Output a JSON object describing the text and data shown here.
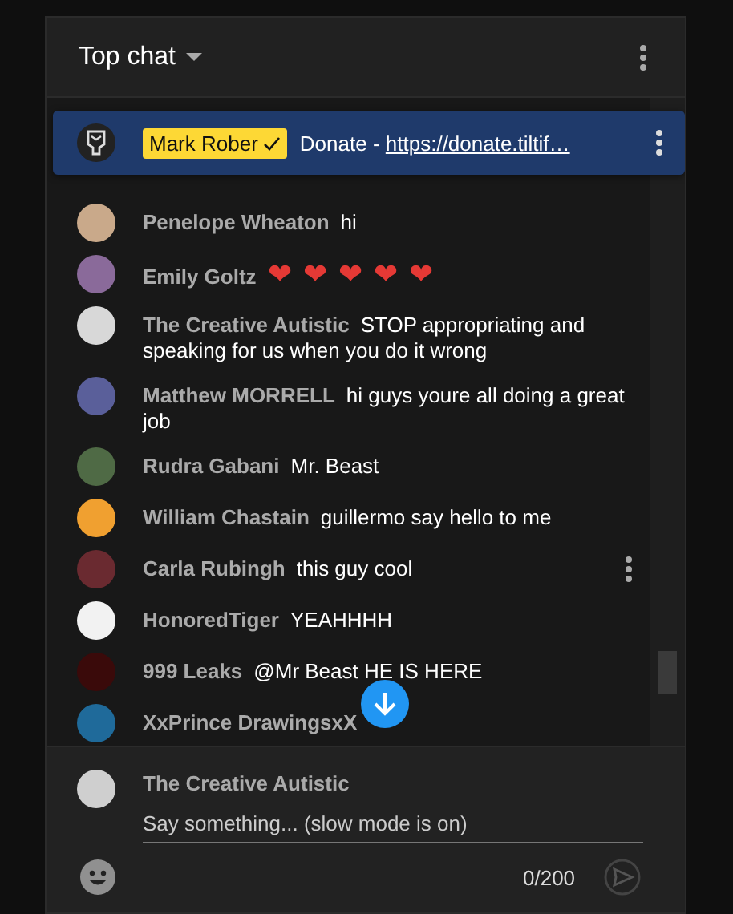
{
  "header": {
    "title": "Top chat"
  },
  "pinned": {
    "author": "Mark Rober",
    "verified": true,
    "text": "Donate - ",
    "link": "https://donate.tiltif…"
  },
  "messages": [
    {
      "author": "Penelope Wheaton",
      "text": "hi",
      "color": "#c9a98a",
      "menu": false
    },
    {
      "author": "Emily Goltz",
      "text": "❤ ❤ ❤ ❤ ❤",
      "color": "#8a6a9a",
      "menu": false
    },
    {
      "author": "The Creative Autistic",
      "text": "STOP appropriating and speaking for us when you do it wrong",
      "color": "#d8d8d8",
      "menu": false
    },
    {
      "author": "Matthew MORRELL",
      "text": "hi guys youre all doing a great job",
      "color": "#5a5f9a",
      "menu": false
    },
    {
      "author": "Rudra Gabani",
      "text": "Mr. Beast",
      "color": "#4f6a45",
      "menu": false
    },
    {
      "author": "William Chastain",
      "text": "guillermo say hello to me",
      "color": "#f0a030",
      "menu": false
    },
    {
      "author": "Carla Rubingh",
      "text": "this guy cool",
      "color": "#6a2a30",
      "menu": true
    },
    {
      "author": "HonoredTiger",
      "text": "YEAHHHH",
      "color": "#f2f2f2",
      "menu": false
    },
    {
      "author": "999 Leaks",
      "text": "@Mr Beast HE IS HERE",
      "color": "#3a0a0a",
      "menu": false
    },
    {
      "author": "XxPrince DrawingsxX",
      "color": "#1f6a9a",
      "menu": false
    }
  ],
  "composer": {
    "author": "The Creative Autistic",
    "placeholder": "Say something... (slow mode is on)",
    "count": "0/200"
  }
}
